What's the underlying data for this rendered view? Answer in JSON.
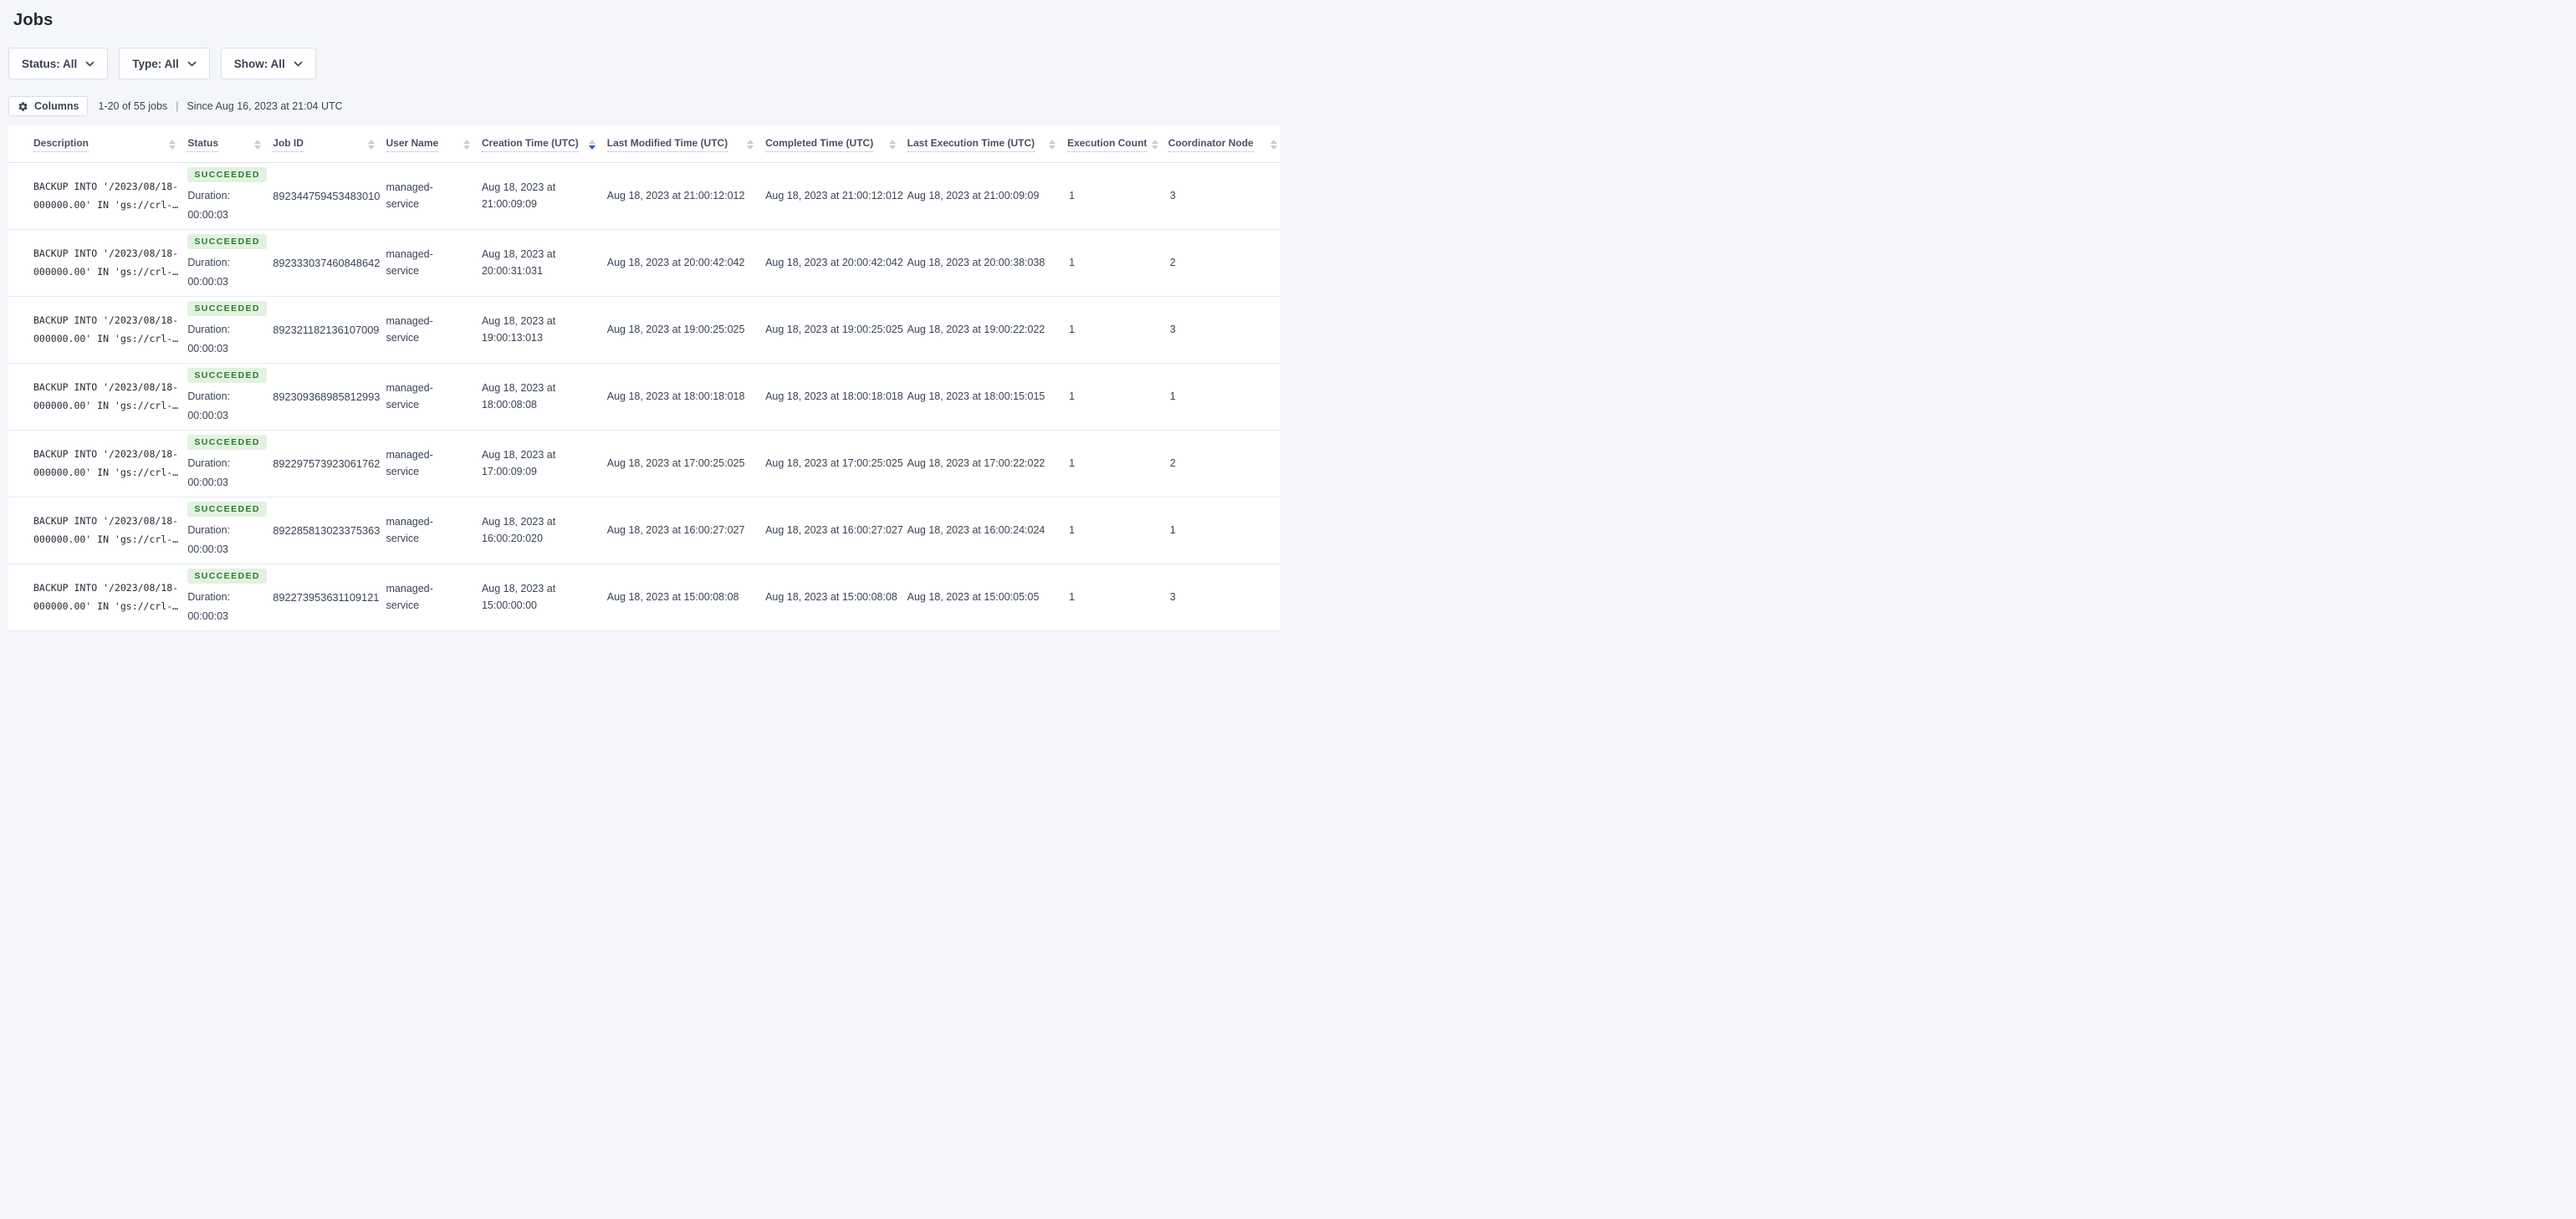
{
  "page": {
    "title": "Jobs"
  },
  "filters": {
    "status": {
      "label": "Status: All",
      "icon": "chevron-down-icon"
    },
    "type": {
      "label": "Type: All",
      "icon": "chevron-down-icon"
    },
    "show": {
      "label": "Show: All",
      "icon": "chevron-down-icon"
    }
  },
  "toolbar": {
    "columns_label": "Columns",
    "columns_icon": "gear-icon",
    "count_text": "1-20 of 55 jobs",
    "separator": "|",
    "since_text": "Since Aug 16, 2023 at 21:04 UTC"
  },
  "colors": {
    "page_background": "#f4f6fa",
    "sort_active_blue": "#2b4af0",
    "badge_succeeded_text": "#2a7d2e",
    "badge_succeeded_background": "#e2f1e0",
    "text_primary": "#394455"
  },
  "table": {
    "sorted_column": "Creation Time (UTC)",
    "sort_direction": "desc",
    "columns": [
      {
        "label": "Description",
        "sortable": true,
        "sorted": null
      },
      {
        "label": "Status",
        "sortable": true,
        "sorted": null
      },
      {
        "label": "Job ID",
        "sortable": true,
        "sorted": null
      },
      {
        "label": "User Name",
        "sortable": true,
        "sorted": null
      },
      {
        "label": "Creation Time (UTC)",
        "sortable": true,
        "sorted": "desc"
      },
      {
        "label": "Last Modified Time (UTC)",
        "sortable": true,
        "sorted": null
      },
      {
        "label": "Completed Time (UTC)",
        "sortable": true,
        "sorted": null
      },
      {
        "label": "Last Execution Time (UTC)",
        "sortable": true,
        "sorted": null
      },
      {
        "label": "Execution Count",
        "sortable": true,
        "sorted": null
      },
      {
        "label": "Coordinator Node",
        "sortable": true,
        "sorted": null
      }
    ],
    "rows": [
      {
        "description_line1": "BACKUP INTO '/2023/08/18-",
        "description_line2": "000000.00' IN 'gs://crl-…",
        "status": "SUCCEEDED",
        "duration_label": "Duration:",
        "duration": "00:00:03",
        "job_id": "892344759453483010",
        "user_name": "managed-service",
        "creation_time": "Aug 18, 2023 at 21:00:09:09",
        "last_modified_time": "Aug 18, 2023 at 21:00:12:012",
        "completed_time": "Aug 18, 2023 at 21:00:12:012",
        "last_execution_time": "Aug 18, 2023 at 21:00:09:09",
        "execution_count": "1",
        "coordinator_node": "3"
      },
      {
        "description_line1": "BACKUP INTO '/2023/08/18-",
        "description_line2": "000000.00' IN 'gs://crl-…",
        "status": "SUCCEEDED",
        "duration_label": "Duration:",
        "duration": "00:00:03",
        "job_id": "892333037460848642",
        "user_name": "managed-service",
        "creation_time": "Aug 18, 2023 at 20:00:31:031",
        "last_modified_time": "Aug 18, 2023 at 20:00:42:042",
        "completed_time": "Aug 18, 2023 at 20:00:42:042",
        "last_execution_time": "Aug 18, 2023 at 20:00:38:038",
        "execution_count": "1",
        "coordinator_node": "2"
      },
      {
        "description_line1": "BACKUP INTO '/2023/08/18-",
        "description_line2": "000000.00' IN 'gs://crl-…",
        "status": "SUCCEEDED",
        "duration_label": "Duration:",
        "duration": "00:00:03",
        "job_id": "892321182136107009",
        "user_name": "managed-service",
        "creation_time": "Aug 18, 2023 at 19:00:13:013",
        "last_modified_time": "Aug 18, 2023 at 19:00:25:025",
        "completed_time": "Aug 18, 2023 at 19:00:25:025",
        "last_execution_time": "Aug 18, 2023 at 19:00:22:022",
        "execution_count": "1",
        "coordinator_node": "3"
      },
      {
        "description_line1": "BACKUP INTO '/2023/08/18-",
        "description_line2": "000000.00' IN 'gs://crl-…",
        "status": "SUCCEEDED",
        "duration_label": "Duration:",
        "duration": "00:00:03",
        "job_id": "892309368985812993",
        "user_name": "managed-service",
        "creation_time": "Aug 18, 2023 at 18:00:08:08",
        "last_modified_time": "Aug 18, 2023 at 18:00:18:018",
        "completed_time": "Aug 18, 2023 at 18:00:18:018",
        "last_execution_time": "Aug 18, 2023 at 18:00:15:015",
        "execution_count": "1",
        "coordinator_node": "1"
      },
      {
        "description_line1": "BACKUP INTO '/2023/08/18-",
        "description_line2": "000000.00' IN 'gs://crl-…",
        "status": "SUCCEEDED",
        "duration_label": "Duration:",
        "duration": "00:00:03",
        "job_id": "892297573923061762",
        "user_name": "managed-service",
        "creation_time": "Aug 18, 2023 at 17:00:09:09",
        "last_modified_time": "Aug 18, 2023 at 17:00:25:025",
        "completed_time": "Aug 18, 2023 at 17:00:25:025",
        "last_execution_time": "Aug 18, 2023 at 17:00:22:022",
        "execution_count": "1",
        "coordinator_node": "2"
      },
      {
        "description_line1": "BACKUP INTO '/2023/08/18-",
        "description_line2": "000000.00' IN 'gs://crl-…",
        "status": "SUCCEEDED",
        "duration_label": "Duration:",
        "duration": "00:00:03",
        "job_id": "892285813023375363",
        "user_name": "managed-service",
        "creation_time": "Aug 18, 2023 at 16:00:20:020",
        "last_modified_time": "Aug 18, 2023 at 16:00:27:027",
        "completed_time": "Aug 18, 2023 at 16:00:27:027",
        "last_execution_time": "Aug 18, 2023 at 16:00:24:024",
        "execution_count": "1",
        "coordinator_node": "1"
      },
      {
        "description_line1": "BACKUP INTO '/2023/08/18-",
        "description_line2": "000000.00' IN 'gs://crl-…",
        "status": "SUCCEEDED",
        "duration_label": "Duration:",
        "duration": "00:00:03",
        "job_id": "892273953631109121",
        "user_name": "managed-service",
        "creation_time": "Aug 18, 2023 at 15:00:00:00",
        "last_modified_time": "Aug 18, 2023 at 15:00:08:08",
        "completed_time": "Aug 18, 2023 at 15:00:08:08",
        "last_execution_time": "Aug 18, 2023 at 15:00:05:05",
        "execution_count": "1",
        "coordinator_node": "3"
      }
    ]
  }
}
